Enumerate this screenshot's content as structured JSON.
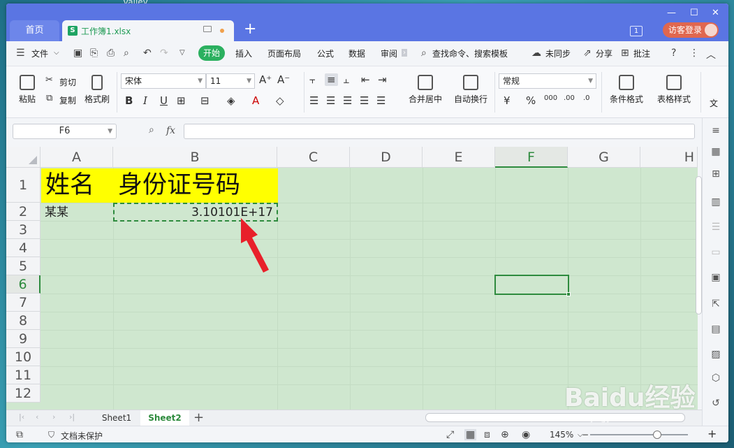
{
  "desktop": {
    "title": "Valley"
  },
  "titlebar": {
    "home_tab": "首页",
    "doc_tab": "工作簿1.xlsx",
    "doc_icon": "S",
    "new_tab": "+",
    "notify_badge": "1",
    "login_label": "访客登录"
  },
  "menu": {
    "file": "文件",
    "start": "开始",
    "insert": "插入",
    "layout": "页面布局",
    "formula": "公式",
    "data": "数据",
    "review": "审阅",
    "search": "查找命令、搜索模板",
    "sync": "未同步",
    "share": "分享",
    "comment": "批注"
  },
  "ribbon": {
    "paste": "粘贴",
    "cut": "剪切",
    "copy": "复制",
    "format_painter": "格式刷",
    "font_name": "宋体",
    "font_size": "11",
    "merge_center": "合并居中",
    "wrap_text": "自动换行",
    "number_format": "常规",
    "cond_format": "条件格式",
    "table_style": "表格样式",
    "more": "文"
  },
  "formula_bar": {
    "name_box": "F6",
    "fx": "fx",
    "formula": ""
  },
  "columns": [
    "A",
    "B",
    "C",
    "D",
    "E",
    "F",
    "G",
    "H"
  ],
  "selected_column": "F",
  "rows": [
    "1",
    "2",
    "3",
    "4",
    "5",
    "6",
    "7",
    "8",
    "9",
    "10",
    "11",
    "12"
  ],
  "selected_row": "6",
  "cells": {
    "A1": "姓名",
    "B1": "身份证号码",
    "A2": "某某",
    "B2": "3.10101E+17"
  },
  "active_cell": "F6",
  "sheets": [
    {
      "name": "Sheet1",
      "active": false
    },
    {
      "name": "Sheet2",
      "active": true
    }
  ],
  "status": {
    "protect": "文档未保护",
    "zoom": "145%",
    "zoom_in": "+",
    "zoom_out": "−"
  },
  "watermark": {
    "brand": "Baidu经验",
    "url": "jingyan.baidu.com"
  },
  "colors": {
    "accent_green": "#2e8b3e",
    "titlebar_blue": "#5a75e3",
    "header_fill": "#ffff00",
    "grid_bg": "#cfe7cf",
    "arrow_red": "#e8202a"
  }
}
